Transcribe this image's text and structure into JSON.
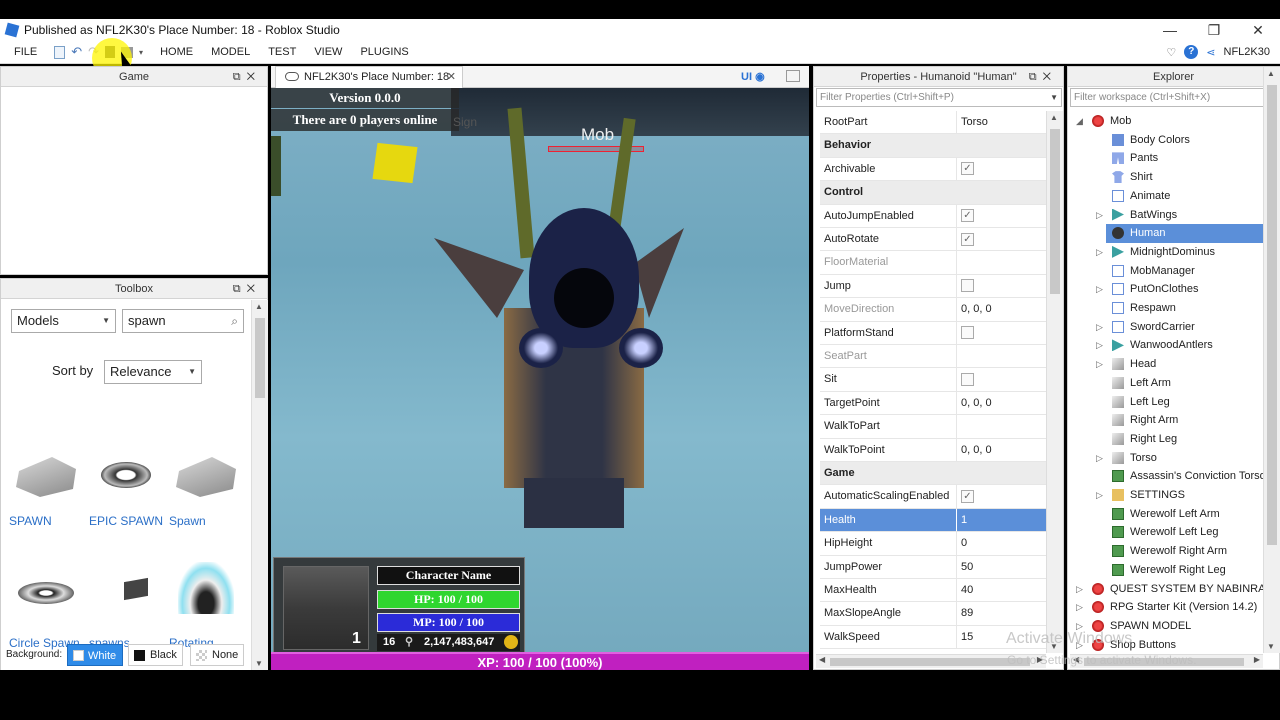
{
  "window": {
    "title": "Published as NFL2K30's Place Number: 18 - Roblox Studio",
    "controls": [
      "—",
      "❐",
      "✕"
    ]
  },
  "ribbon": {
    "file": "FILE",
    "tabs": [
      "HOME",
      "MODEL",
      "TEST",
      "VIEW",
      "PLUGINS"
    ],
    "user": "NFL2K30"
  },
  "game_panel": {
    "title": "Game"
  },
  "toolbox": {
    "title": "Toolbox",
    "category": "Models",
    "search_value": "spawn",
    "sort_label": "Sort by",
    "sort_value": "Relevance",
    "items": [
      "SPAWN",
      "EPIC SPAWN",
      "Spawn",
      "Circle Spawn",
      "spawns",
      "Rotating"
    ],
    "background_label": "Background:",
    "bg_options": [
      "White",
      "Black",
      "None"
    ]
  },
  "viewport": {
    "tab_title": "NFL2K30's Place Number: 18",
    "ui_label": "UI",
    "version": "Version 0.0.0",
    "players": "There are 0 players online",
    "sign": "Sign",
    "mob_label": "Mob",
    "char_name_label": "Character Name",
    "hp": "HP: 100 / 100",
    "mp": "MP: 100 / 100",
    "level": "1",
    "level_small": "16",
    "gold": "2,147,483,647",
    "xp": "XP: 100 / 100 (100%)",
    "hp_fraction": 1.0,
    "mp_fraction": 1.0,
    "xp_fraction": 1.0
  },
  "properties": {
    "title": "Properties - Humanoid \"Human\"",
    "filter_placeholder": "Filter Properties (Ctrl+Shift+P)",
    "rows": [
      {
        "k": "RootPart",
        "v": "Torso"
      },
      {
        "k": "Behavior",
        "cat": true
      },
      {
        "k": "Archivable",
        "cb": "✓"
      },
      {
        "k": "Control",
        "cat": true
      },
      {
        "k": "AutoJumpEnabled",
        "cb": "✓"
      },
      {
        "k": "AutoRotate",
        "cb": "✓"
      },
      {
        "k": "FloorMaterial",
        "v": "",
        "dis": true
      },
      {
        "k": "Jump",
        "cb": ""
      },
      {
        "k": "MoveDirection",
        "v": "0, 0, 0",
        "dis": true
      },
      {
        "k": "PlatformStand",
        "cb": ""
      },
      {
        "k": "SeatPart",
        "v": "",
        "dis": true
      },
      {
        "k": "Sit",
        "cb": ""
      },
      {
        "k": "TargetPoint",
        "v": "0, 0, 0"
      },
      {
        "k": "WalkToPart",
        "v": ""
      },
      {
        "k": "WalkToPoint",
        "v": "0, 0, 0"
      },
      {
        "k": "Game",
        "cat": true
      },
      {
        "k": "AutomaticScalingEnabled",
        "cb": "✓"
      },
      {
        "k": "Health",
        "v": "1",
        "hl": true
      },
      {
        "k": "HipHeight",
        "v": "0"
      },
      {
        "k": "JumpPower",
        "v": "50"
      },
      {
        "k": "MaxHealth",
        "v": "40"
      },
      {
        "k": "MaxSlopeAngle",
        "v": "89"
      },
      {
        "k": "WalkSpeed",
        "v": "15"
      }
    ]
  },
  "explorer": {
    "title": "Explorer",
    "filter_placeholder": "Filter workspace (Ctrl+Shift+X)",
    "rows": [
      {
        "n": "Mob",
        "d": 0,
        "tw": "◢",
        "ic": "model"
      },
      {
        "n": "Body Colors",
        "d": 1,
        "ic": "colors"
      },
      {
        "n": "Pants",
        "d": 1,
        "ic": "pants"
      },
      {
        "n": "Shirt",
        "d": 1,
        "ic": "shirt"
      },
      {
        "n": "Animate",
        "d": 1,
        "ic": "script"
      },
      {
        "n": "BatWings",
        "d": 1,
        "tw": "▷",
        "ic": "tool"
      },
      {
        "n": "Human",
        "d": 1,
        "ic": "humanoid",
        "hl": true
      },
      {
        "n": "MidnightDominus",
        "d": 1,
        "tw": "▷",
        "ic": "tool"
      },
      {
        "n": "MobManager",
        "d": 1,
        "ic": "script"
      },
      {
        "n": "PutOnClothes",
        "d": 1,
        "tw": "▷",
        "ic": "script"
      },
      {
        "n": "Respawn",
        "d": 1,
        "ic": "script"
      },
      {
        "n": "SwordCarrier",
        "d": 1,
        "tw": "▷",
        "ic": "script"
      },
      {
        "n": "WanwoodAntlers",
        "d": 1,
        "tw": "▷",
        "ic": "tool"
      },
      {
        "n": "Head",
        "d": 1,
        "tw": "▷",
        "ic": "part"
      },
      {
        "n": "Left Arm",
        "d": 1,
        "ic": "part"
      },
      {
        "n": "Left Leg",
        "d": 1,
        "ic": "part"
      },
      {
        "n": "Right Arm",
        "d": 1,
        "ic": "part"
      },
      {
        "n": "Right Leg",
        "d": 1,
        "ic": "part"
      },
      {
        "n": "Torso",
        "d": 1,
        "tw": "▷",
        "ic": "part"
      },
      {
        "n": "Assassin's Conviction Torso",
        "d": 1,
        "ic": "mesh"
      },
      {
        "n": "SETTINGS",
        "d": 1,
        "tw": "▷",
        "ic": "folder"
      },
      {
        "n": "Werewolf Left Arm",
        "d": 1,
        "ic": "mesh"
      },
      {
        "n": "Werewolf Left Leg",
        "d": 1,
        "ic": "mesh"
      },
      {
        "n": "Werewolf Right Arm",
        "d": 1,
        "ic": "mesh"
      },
      {
        "n": "Werewolf Right Leg",
        "d": 1,
        "ic": "mesh"
      },
      {
        "n": "QUEST SYSTEM BY NABINRAJ",
        "d": 0,
        "tw": "▷",
        "ic": "model"
      },
      {
        "n": "RPG Starter Kit (Version 14.2)",
        "d": 0,
        "tw": "▷",
        "ic": "model"
      },
      {
        "n": "SPAWN MODEL",
        "d": 0,
        "tw": "▷",
        "ic": "model"
      },
      {
        "n": "Shop Buttons",
        "d": 0,
        "tw": "▷",
        "ic": "model"
      }
    ]
  },
  "watermark": {
    "line1": "Activate Windows",
    "line2": "Go to Settings to activate Windows."
  },
  "colors": {
    "selection": "#5b8fd9",
    "hp": "#2fd62f",
    "mp": "#2b2bd8",
    "xp": "#c020c0",
    "link": "#2b6fc7"
  }
}
